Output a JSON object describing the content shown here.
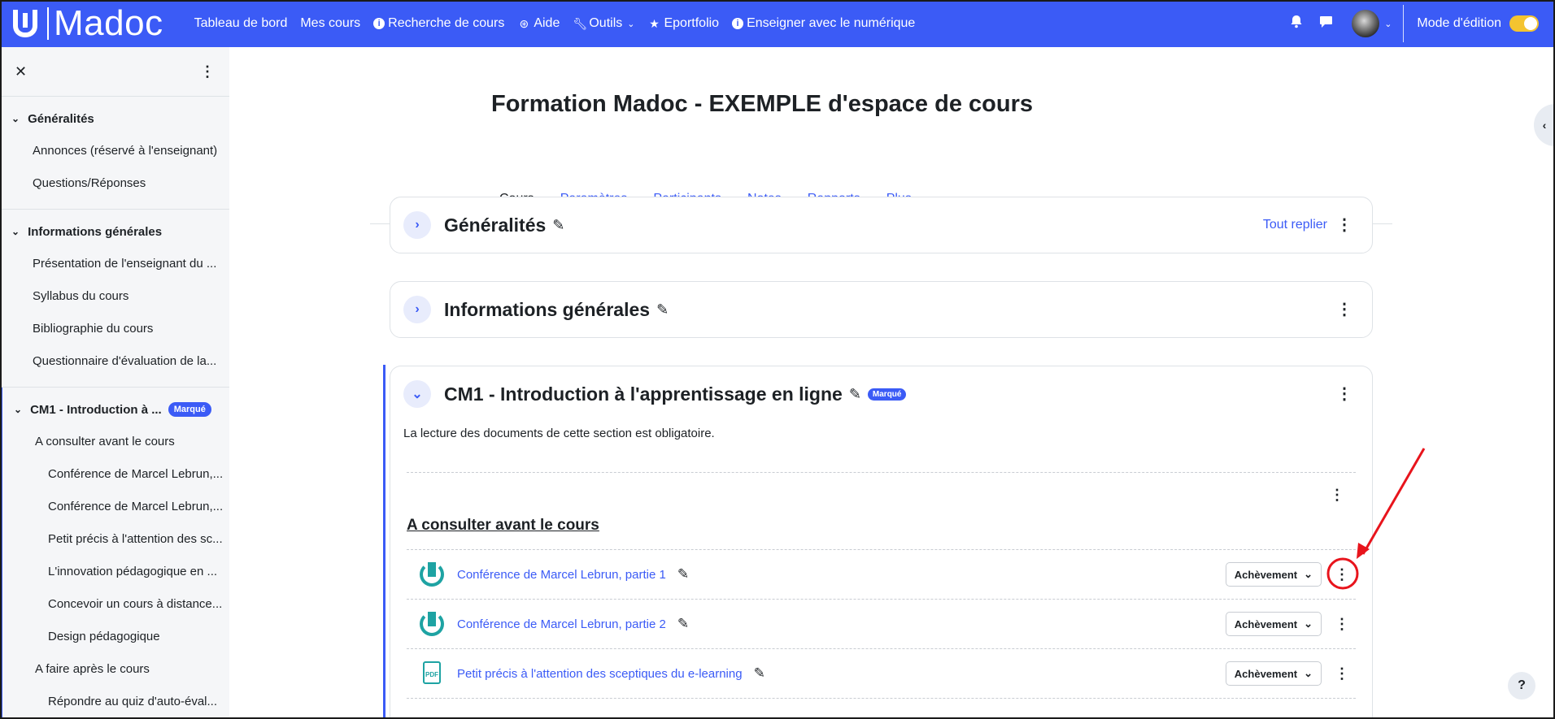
{
  "navbar": {
    "brand": "Madoc",
    "links": [
      {
        "label": "Tableau de bord",
        "icon": ""
      },
      {
        "label": "Mes cours",
        "icon": ""
      },
      {
        "label": "Recherche de cours",
        "icon": "info-icon"
      },
      {
        "label": "Aide",
        "icon": "lifebuoy-icon"
      },
      {
        "label": "Outils",
        "icon": "wrench-icon"
      },
      {
        "label": "Eportfolio",
        "icon": "star-icon"
      },
      {
        "label": "Enseigner avec le numérique",
        "icon": "info-icon"
      }
    ],
    "edit_mode_label": "Mode d'édition",
    "edit_mode_on": true
  },
  "drawer": {
    "sections": [
      {
        "title": "Généralités",
        "badge": "",
        "items": [
          {
            "label": "Annonces (réservé à l'enseignant)"
          },
          {
            "label": "Questions/Réponses"
          }
        ]
      },
      {
        "title": "Informations générales",
        "badge": "",
        "items": [
          {
            "label": "Présentation de l'enseignant du ..."
          },
          {
            "label": "Syllabus du cours"
          },
          {
            "label": "Bibliographie du cours"
          },
          {
            "label": "Questionnaire d'évaluation de la..."
          }
        ]
      },
      {
        "title": "CM1 - Introduction à ...",
        "badge": "Marqué",
        "items": [
          {
            "label": "A consulter avant le cours"
          },
          {
            "label": "Conférence de Marcel Lebrun,..."
          },
          {
            "label": "Conférence de Marcel Lebrun,..."
          },
          {
            "label": "Petit précis à l'attention des sc..."
          },
          {
            "label": "L'innovation pédagogique en ..."
          },
          {
            "label": "Concevoir un cours à distance..."
          },
          {
            "label": "Design pédagogique"
          },
          {
            "label": "A faire après le cours"
          },
          {
            "label": "Répondre au quiz d'auto-éval..."
          }
        ]
      }
    ]
  },
  "course": {
    "title": "Formation Madoc - EXEMPLE d'espace de cours",
    "tabs": [
      "Cours",
      "Paramètres",
      "Participants",
      "Notes",
      "Rapports",
      "Plus"
    ],
    "active_tab": "Cours",
    "collapse_all": "Tout replier",
    "sections": [
      {
        "title": "Généralités"
      },
      {
        "title": "Informations générales"
      },
      {
        "title": "CM1 - Introduction à l'apprentissage en ligne",
        "badge": "Marqué",
        "description": "La lecture des documents de cette section est obligatoire."
      }
    ],
    "subsection_title": "A consulter avant le cours",
    "activities": [
      {
        "name": "Conférence de Marcel Lebrun, partie 1",
        "type": "url",
        "completion": "Achèvement"
      },
      {
        "name": "Conférence de Marcel Lebrun, partie 2",
        "type": "url",
        "completion": "Achèvement"
      },
      {
        "name": "Petit précis à l'attention des sceptiques du e-learning",
        "type": "pdf",
        "completion": "Achèvement"
      }
    ],
    "pdf_label": "PDF"
  },
  "colors": {
    "brand": "#3b5bf6",
    "accent_toggle": "#f4c430",
    "annotation": "#e8141c",
    "activity_icon": "#1ea3a3"
  }
}
